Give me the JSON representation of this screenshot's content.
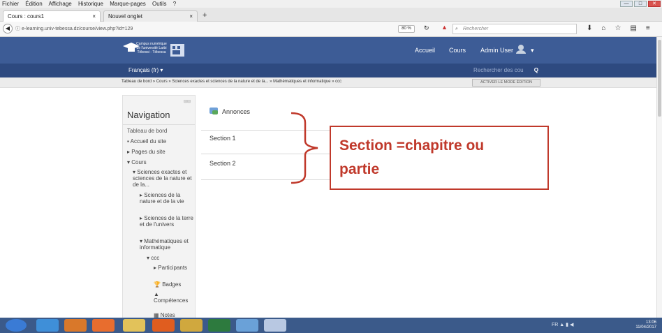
{
  "menu": [
    "Fichier",
    "Édition",
    "Affichage",
    "Historique",
    "Marque-pages",
    "Outils",
    "?"
  ],
  "window_buttons": {
    "min": "—",
    "max": "□",
    "close": "✕"
  },
  "tabs": [
    {
      "label": "Cours : cours1",
      "close": "×"
    },
    {
      "label": "Nouvel onglet",
      "close": "×"
    }
  ],
  "new_tab": "+",
  "url": "e-learning.univ-tebessa.dz/course/view.php?id=129",
  "zoom": "80 %",
  "browser_search_placeholder": "Rechercher",
  "site_logo_text": "Campus numérique de l'université Larbi Tébessi - Tébessa",
  "topnav": {
    "accueil": "Accueil",
    "cours": "Cours",
    "user": "Admin User",
    "caret": "▾"
  },
  "language": "Français (fr) ▾",
  "moodle_search_placeholder": "Rechercher des cou",
  "moodle_search_icon": "Q",
  "breadcrumb": "Tableau de bord » Cours » Sciences exactes et sciences de la nature et de la... » Mathématiques et informatique » ccc",
  "edit_mode_button": "ACTIVER LE MODE ÉDITION",
  "navigation": {
    "controls": "⊟⊟",
    "title": "Navigation",
    "items": [
      "Tableau de bord",
      "Accueil du site",
      "Pages du site",
      "Cours",
      "Sciences exactes et sciences de la nature et de la...",
      "Sciences de la nature et de la vie",
      "Sciences de la terre et de l'univers",
      "Mathématiques et informatique",
      "ccc",
      "Participants",
      "Badges",
      "Compétences",
      "Notes"
    ]
  },
  "sections": {
    "announcements": "Annonces",
    "s1": "Section 1",
    "s2": "Section 2"
  },
  "annotation": {
    "line1": "Section =chapitre ou",
    "line2": "partie",
    "color": "#c0392b"
  },
  "clock": {
    "time": "13:06",
    "date": "11/04/2017"
  },
  "tray_lang": "FR"
}
